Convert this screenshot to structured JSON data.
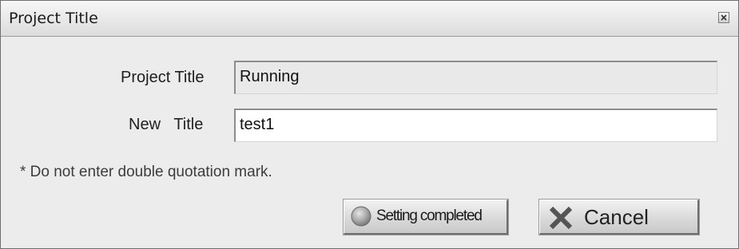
{
  "window": {
    "title": "Project Title"
  },
  "form": {
    "project_title_label": "Project Title",
    "project_title_value": "Running",
    "new_title_label": "New   Title",
    "new_title_value": "test1"
  },
  "note": "* Do not enter double quotation mark.",
  "buttons": {
    "setting_completed_label": "Setting completed",
    "cancel_label": "Cancel"
  },
  "icons": {
    "close": "close-icon",
    "setting": "status-circle-icon",
    "cancel": "x-icon"
  }
}
